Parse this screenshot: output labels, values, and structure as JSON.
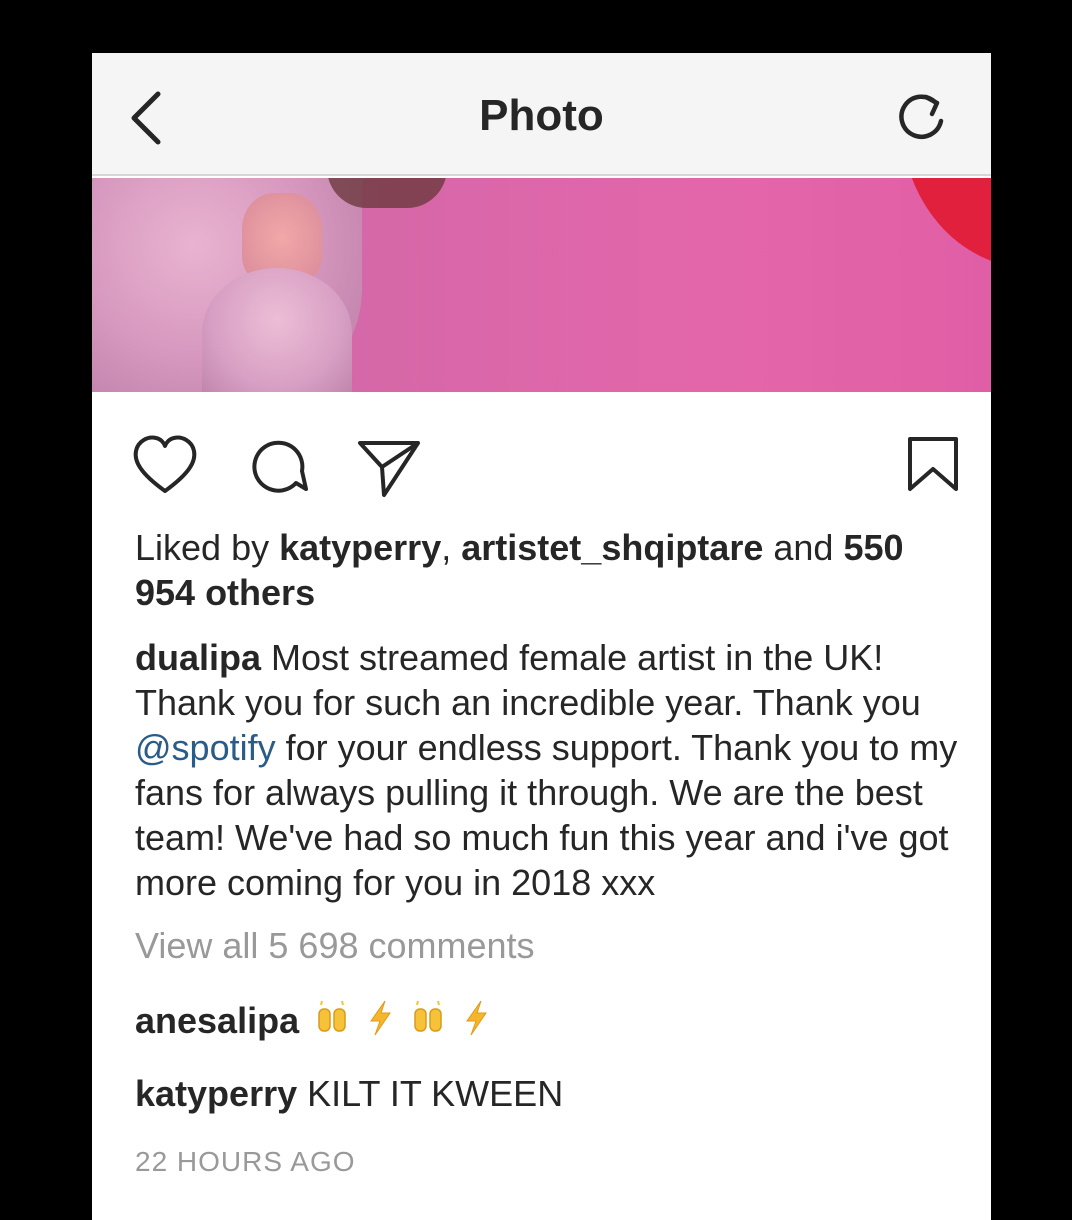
{
  "nav": {
    "title": "Photo",
    "back_icon": "chevron-left-icon",
    "refresh_icon": "refresh-icon"
  },
  "photo": {
    "colors": {
      "background": "#d967a9",
      "accent_red": "#e0203d"
    }
  },
  "actions": {
    "icons": [
      "heart-icon",
      "comment-icon",
      "share-icon",
      "bookmark-icon"
    ]
  },
  "likes": {
    "prefix": "Liked by",
    "user1": "katyperry",
    "separator": ",",
    "user2": "artistet_shqiptare",
    "joiner": "and",
    "others": "550 954 others"
  },
  "caption": {
    "author": "dualipa",
    "text_before_mention": "Most streamed female artist in the UK! Thank you for such an incredible year. Thank you",
    "mention": "@spotify",
    "text_after_mention": "for your endless support. Thank you to my fans for always pulling it through. We are the best team! We've had so much fun this year and i've got more coming for you in 2018 xxx"
  },
  "view_all_comments": "View all 5 698 comments",
  "comments": [
    {
      "user": "anesalipa",
      "text": "",
      "emojis": [
        "raising-hands-emoji",
        "lightning-emoji",
        "raising-hands-emoji",
        "lightning-emoji"
      ]
    },
    {
      "user": "katyperry",
      "text": "KILT IT KWEEN"
    }
  ],
  "timestamp": "22 HOURS AGO",
  "colors": {
    "text": "#262626",
    "muted": "#999999",
    "mention": "#2a5c8a",
    "navbar_bg": "#f5f5f5"
  }
}
